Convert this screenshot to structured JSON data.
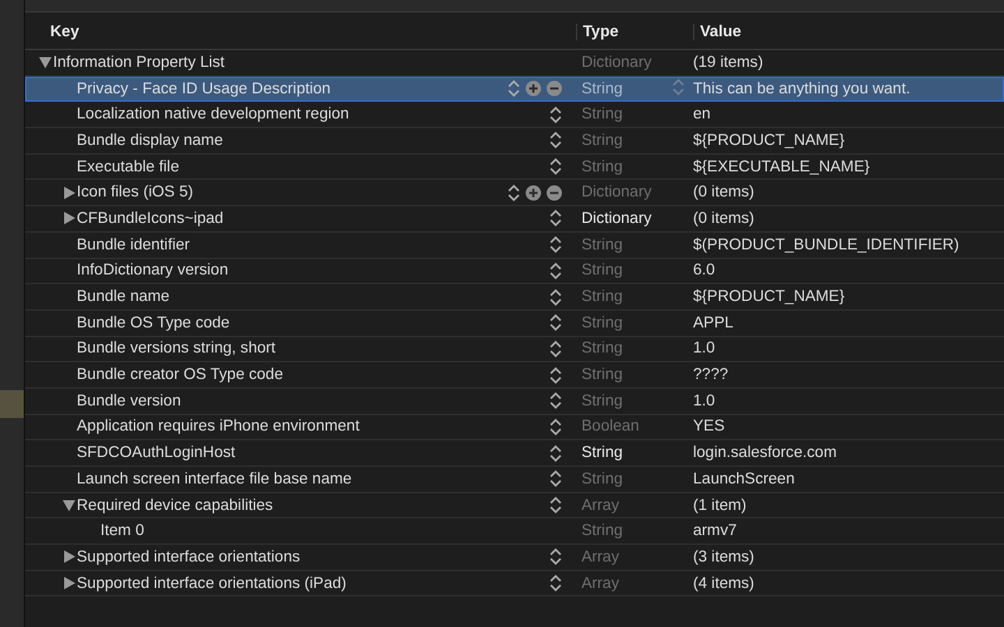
{
  "columns": [
    "Key",
    "Type",
    "Value"
  ],
  "rows": [
    {
      "key": "Information Property List",
      "type": "Dictionary",
      "value": "(19 items)",
      "selected": false,
      "custom": false,
      "expanded": true,
      "children": [
        {
          "key": "Privacy - Face ID Usage Description",
          "type": "String",
          "value": "This can be anything you want.",
          "selected": true,
          "custom": false,
          "kind": "editable"
        },
        {
          "key": "Localization native development region",
          "type": "String",
          "value": "en",
          "selected": false,
          "custom": false,
          "kind": "stepper"
        },
        {
          "key": "Bundle display name",
          "type": "String",
          "value": "${PRODUCT_NAME}",
          "selected": false,
          "custom": false,
          "kind": "stepper"
        },
        {
          "key": "Executable file",
          "type": "String",
          "value": "${EXECUTABLE_NAME}",
          "selected": false,
          "custom": false,
          "kind": "stepper"
        },
        {
          "key": "Icon files (iOS 5)",
          "type": "Dictionary",
          "value": "(0 items)",
          "selected": false,
          "custom": false,
          "kind": "editable",
          "expanded": false
        },
        {
          "key": "CFBundleIcons~ipad",
          "type": "Dictionary",
          "value": "(0 items)",
          "selected": false,
          "custom": true,
          "kind": "stepper",
          "expanded": false
        },
        {
          "key": "Bundle identifier",
          "type": "String",
          "value": "$(PRODUCT_BUNDLE_IDENTIFIER)",
          "selected": false,
          "custom": false,
          "kind": "stepper"
        },
        {
          "key": "InfoDictionary version",
          "type": "String",
          "value": "6.0",
          "selected": false,
          "custom": false,
          "kind": "stepper"
        },
        {
          "key": "Bundle name",
          "type": "String",
          "value": "${PRODUCT_NAME}",
          "selected": false,
          "custom": false,
          "kind": "stepper"
        },
        {
          "key": "Bundle OS Type code",
          "type": "String",
          "value": "APPL",
          "selected": false,
          "custom": false,
          "kind": "stepper"
        },
        {
          "key": "Bundle versions string, short",
          "type": "String",
          "value": "1.0",
          "selected": false,
          "custom": false,
          "kind": "stepper"
        },
        {
          "key": "Bundle creator OS Type code",
          "type": "String",
          "value": "????",
          "selected": false,
          "custom": false,
          "kind": "stepper"
        },
        {
          "key": "Bundle version",
          "type": "String",
          "value": "1.0",
          "selected": false,
          "custom": false,
          "kind": "stepper"
        },
        {
          "key": "Application requires iPhone environment",
          "type": "Boolean",
          "value": "YES",
          "selected": false,
          "custom": false,
          "kind": "stepper"
        },
        {
          "key": "SFDCOAuthLoginHost",
          "type": "String",
          "value": "login.salesforce.com",
          "selected": false,
          "custom": true,
          "kind": "stepper"
        },
        {
          "key": "Launch screen interface file base name",
          "type": "String",
          "value": "LaunchScreen",
          "selected": false,
          "custom": false,
          "kind": "stepper"
        },
        {
          "key": "Required device capabilities",
          "type": "Array",
          "value": "(1 item)",
          "selected": false,
          "custom": false,
          "kind": "stepper",
          "expanded": true,
          "children": [
            {
              "key": "Item 0",
              "type": "String",
              "value": "armv7",
              "selected": false,
              "custom": false
            }
          ]
        },
        {
          "key": "Supported interface orientations",
          "type": "Array",
          "value": "(3 items)",
          "selected": false,
          "custom": false,
          "kind": "stepper",
          "expanded": false
        },
        {
          "key": "Supported interface orientations (iPad)",
          "type": "Array",
          "value": "(4 items)",
          "selected": false,
          "custom": false,
          "kind": "stepper",
          "expanded": false
        }
      ]
    }
  ]
}
